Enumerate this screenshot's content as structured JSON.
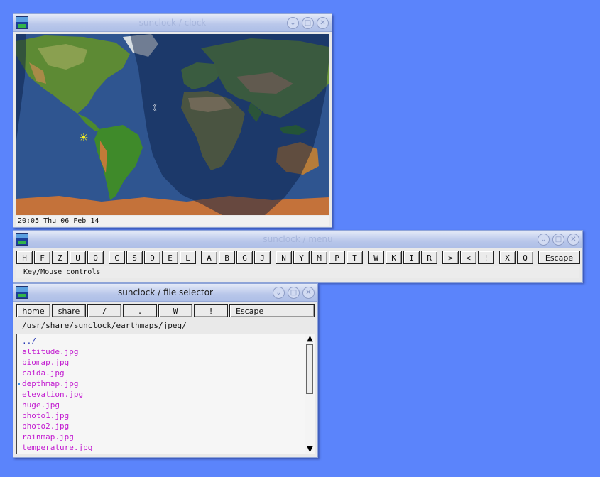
{
  "clock_window": {
    "title": "sunclock / clock",
    "status": "20:05 Thu 06 Feb 14",
    "sun_glyph": "☀",
    "moon_glyph": "☾"
  },
  "menu_window": {
    "title": "sunclock / menu",
    "keys": [
      "H",
      "F",
      "Z",
      "U",
      "O",
      "C",
      "S",
      "D",
      "E",
      "L",
      "A",
      "B",
      "G",
      "J",
      "N",
      "Y",
      "M",
      "P",
      "T",
      "W",
      "K",
      "I",
      "R",
      ">",
      "<",
      "!",
      "X",
      "Q",
      "Escape"
    ],
    "status": "Key/Mouse controls"
  },
  "file_window": {
    "title": "sunclock / file selector",
    "buttons": [
      "home",
      "share",
      "/",
      ".",
      "W",
      "!",
      "Escape"
    ],
    "path": "/usr/share/sunclock/earthmaps/jpeg/",
    "items": [
      {
        "label": "../",
        "kind": "dir"
      },
      {
        "label": "altitude.jpg",
        "kind": "file"
      },
      {
        "label": "biomap.jpg",
        "kind": "file"
      },
      {
        "label": "caida.jpg",
        "kind": "file"
      },
      {
        "label": "depthmap.jpg",
        "kind": "file",
        "current": true
      },
      {
        "label": "elevation.jpg",
        "kind": "file"
      },
      {
        "label": "huge.jpg",
        "kind": "file"
      },
      {
        "label": "photo1.jpg",
        "kind": "file"
      },
      {
        "label": "photo2.jpg",
        "kind": "file"
      },
      {
        "label": "rainmap.jpg",
        "kind": "file"
      },
      {
        "label": "temperature.jpg",
        "kind": "file"
      }
    ],
    "scroll_up": "▲",
    "scroll_down": "▼"
  },
  "window_controls": {
    "minimize": "⌄",
    "maximize": "□",
    "close": "✕"
  },
  "colors": {
    "desktop": "#5b84fb",
    "dir": "#1a2db0",
    "file": "#c21bd0"
  }
}
